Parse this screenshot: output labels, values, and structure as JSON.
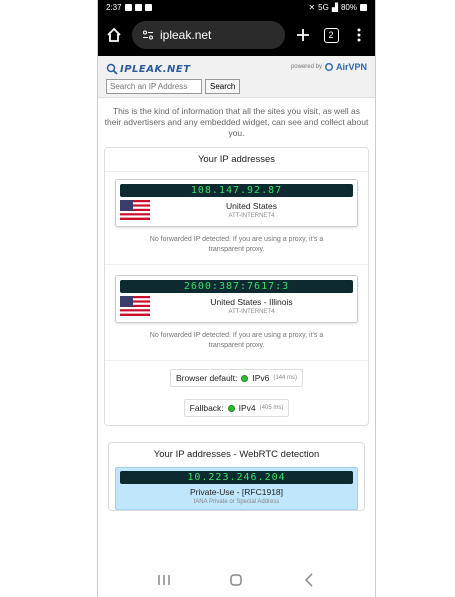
{
  "status_bar": {
    "time": "2:37",
    "signal": "5G",
    "battery": "80%"
  },
  "browser": {
    "url": "ipleak.net",
    "tab_count": "2"
  },
  "site": {
    "logo_text": "IPLEAK.NET",
    "powered_by": "powered by",
    "brand": "AirVPN",
    "search_placeholder": "Search an IP Address",
    "search_button": "Search"
  },
  "intro": "This is the kind of information that all the sites you visit, as well as their advertisers and any embedded widget, can see and collect about you.",
  "ip_section": {
    "title": "Your IP addresses",
    "entries": [
      {
        "ip": "108.147.92.87",
        "location": "United States",
        "isp": "ATT-INTERNET4",
        "note": "No forwarded IP detected. If you are using a proxy, it's a transparent proxy."
      },
      {
        "ip": "2600:387:7617:3",
        "location": "United States - Illinois",
        "isp": "ATT-INTERNET4",
        "note": "No forwarded IP detected. If you are using a proxy, it's a transparent proxy."
      }
    ],
    "browser_default": {
      "label": "Browser default:",
      "value": "IPv6",
      "ms": "(144 ms)"
    },
    "fallback": {
      "label": "Fallback:",
      "value": "IPv4",
      "ms": "(405 ms)"
    }
  },
  "webrtc": {
    "title": "Your IP addresses - WebRTC detection",
    "ip": "10.223.246.204",
    "location": "Private-Use - [RFC1918]",
    "desc": "IANA Private or Special Address"
  },
  "colors": {
    "ip_bar_bg": "#0d2a30",
    "ip_text": "#33e06a",
    "webrtc_bg": "#bfe6fb",
    "status_dot": "#2fbf2f"
  }
}
